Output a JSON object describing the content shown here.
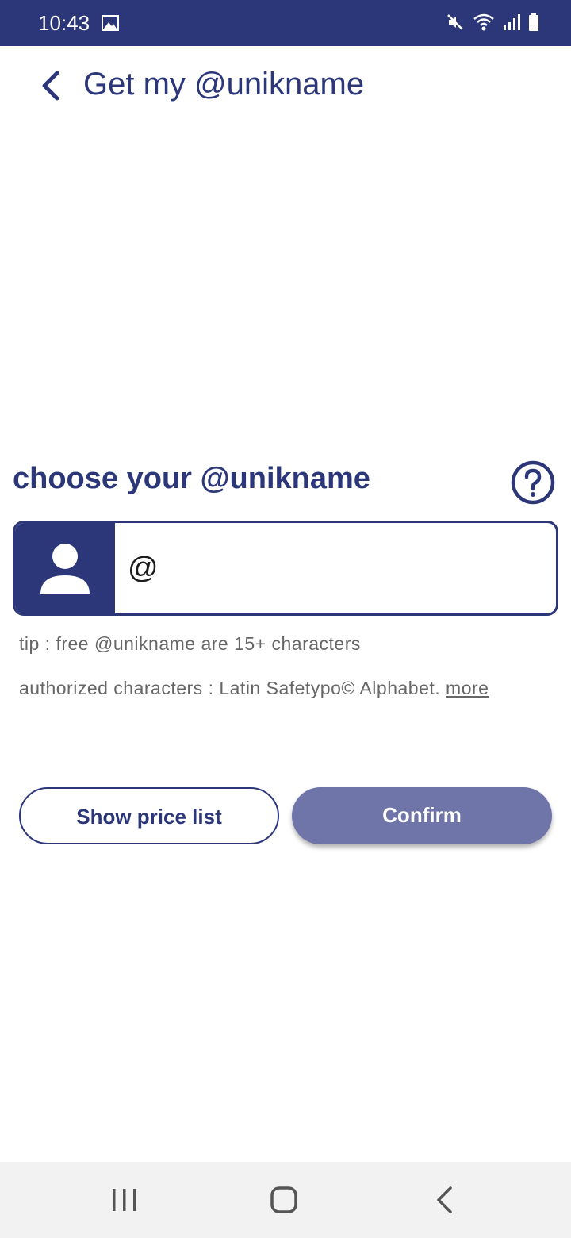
{
  "status_bar": {
    "time": "10:43",
    "icons": [
      "gallery-icon",
      "mute-icon",
      "wifi-icon",
      "signal-icon",
      "battery-icon"
    ],
    "background": "#2c377a"
  },
  "header": {
    "back_icon": "chevron-left-icon",
    "title": "Get my @unikname"
  },
  "form": {
    "section_title": "choose your @unikname",
    "help_icon": "question-circle-icon",
    "avatar_icon": "person-icon",
    "input_prefix": "@",
    "input_value": "",
    "tip": "tip : free @unikname are 15+ characters",
    "authorized_text": "authorized characters : Latin Safetypo© Alphabet.",
    "more_link": "more"
  },
  "actions": {
    "price_list_label": "Show price list",
    "confirm_label": "Confirm"
  },
  "nav_bar": {
    "icons": [
      "recents-icon",
      "home-icon",
      "back-icon"
    ]
  },
  "colors": {
    "primary": "#2c377a",
    "confirm_disabled": "#6f75a9",
    "muted_text": "#666666"
  }
}
